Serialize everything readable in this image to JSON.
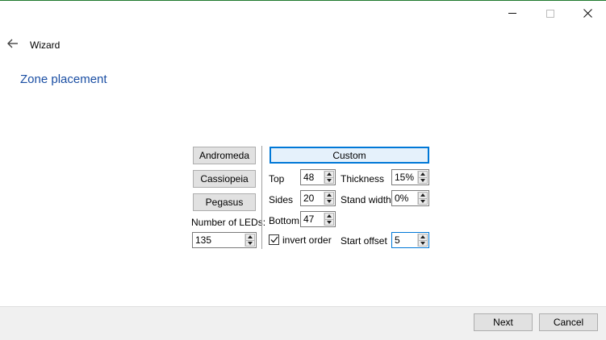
{
  "window": {
    "minimize_icon": "minimize-icon",
    "maximize_icon": "maximize-icon",
    "close_icon": "close-icon"
  },
  "header": {
    "back_icon": "arrow-left-icon",
    "wizard_label": "Wizard",
    "page_title": "Zone placement"
  },
  "presets": {
    "andromeda": "Andromeda",
    "cassiopeia": "Cassiopeia",
    "pegasus": "Pegasus",
    "num_leds_label": "Number of LEDs:",
    "num_leds_value": "135"
  },
  "custom": {
    "custom_label": "Custom",
    "top_label": "Top",
    "top_value": "48",
    "sides_label": "Sides",
    "sides_value": "20",
    "bottom_label": "Bottom",
    "bottom_value": "47",
    "thickness_label": "Thickness",
    "thickness_value": "15%",
    "stand_width_label": "Stand width",
    "stand_width_value": "0%",
    "invert_order_label": "invert order",
    "invert_order_checked": true,
    "start_offset_label": "Start offset",
    "start_offset_value": "5"
  },
  "footer": {
    "next_label": "Next",
    "cancel_label": "Cancel"
  },
  "colors": {
    "title_blue": "#1a4ea3",
    "focus_blue": "#0078d7",
    "footer_bg": "#f0f0f0"
  }
}
